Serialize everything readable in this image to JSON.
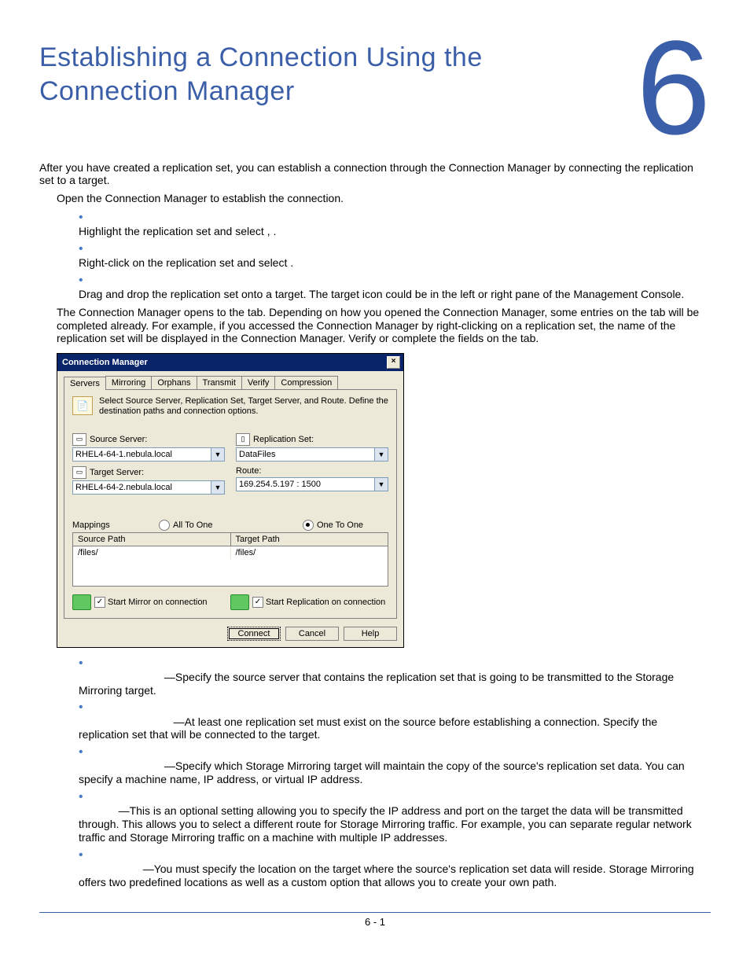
{
  "chapter": {
    "title": "Establishing a Connection Using the Connection Manager",
    "number": "6"
  },
  "intro": "After you have created a replication set, you can establish a connection through the Connection Manager by connecting the replication set to a target.",
  "step_open": "Open the Connection Manager to establish the connection.",
  "open_methods": [
    "Highlight the replication set and select            ,                                        .",
    "Right-click on the replication set and select                                        .",
    "Drag and drop the replication set onto a target. The target icon could be in the left or right pane of the Management Console."
  ],
  "after_open": "The Connection Manager opens to the                 tab. Depending on how you opened the Connection Manager, some entries on the                  tab will be completed already. For example, if you accessed the Connection Manager by right-clicking on a replication set, the name of the replication set will be displayed in the Connection Manager. Verify or complete the fields on the                tab.",
  "dialog": {
    "title": "Connection Manager",
    "tabs": [
      "Servers",
      "Mirroring",
      "Orphans",
      "Transmit",
      "Verify",
      "Compression"
    ],
    "instruction": "Select Source Server, Replication Set, Target Server, and Route.  Define the destination paths and connection options.",
    "source_server_label": "Source Server:",
    "source_server_value": "RHEL4-64-1.nebula.local",
    "target_server_label": "Target Server:",
    "target_server_value": "RHEL4-64-2.nebula.local",
    "repset_label": "Replication Set:",
    "repset_value": "DataFiles",
    "route_label": "Route:",
    "route_value": "169.254.5.197 : 1500",
    "mappings_label": "Mappings",
    "radio_all": "All To One",
    "radio_one": "One To One",
    "col_source": "Source Path",
    "col_target": "Target Path",
    "row_source": "/files/",
    "row_target": "/files/",
    "chk_mirror": "Start Mirror on connection",
    "chk_repl": "Start Replication on connection",
    "btn_connect": "Connect",
    "btn_cancel": "Cancel",
    "btn_help": "Help"
  },
  "field_desc": [
    "—Specify the source server that contains the replication set that is going to be transmitted to the Storage Mirroring target.",
    "—At least one replication set must exist on the source before establishing a connection. Specify the replication set that will be connected to the target.",
    "—Specify which Storage Mirroring target will maintain the copy of the source's replication set data. You can specify a machine name, IP address, or virtual IP address.",
    "—This is an optional setting allowing you to specify the IP address and port on the target the data will be transmitted through. This allows you to select a different route for Storage Mirroring traffic. For example, you can separate regular network traffic and Storage Mirroring traffic on a machine with multiple IP addresses.",
    "—You must specify the location on the target where the source's replication set data will reside. Storage Mirroring offers two predefined locations as well as a custom option that allows you to create your own path."
  ],
  "field_pad": [
    "                            ",
    "                               ",
    "                            ",
    "             ",
    "                     "
  ],
  "footer": "6 - 1"
}
